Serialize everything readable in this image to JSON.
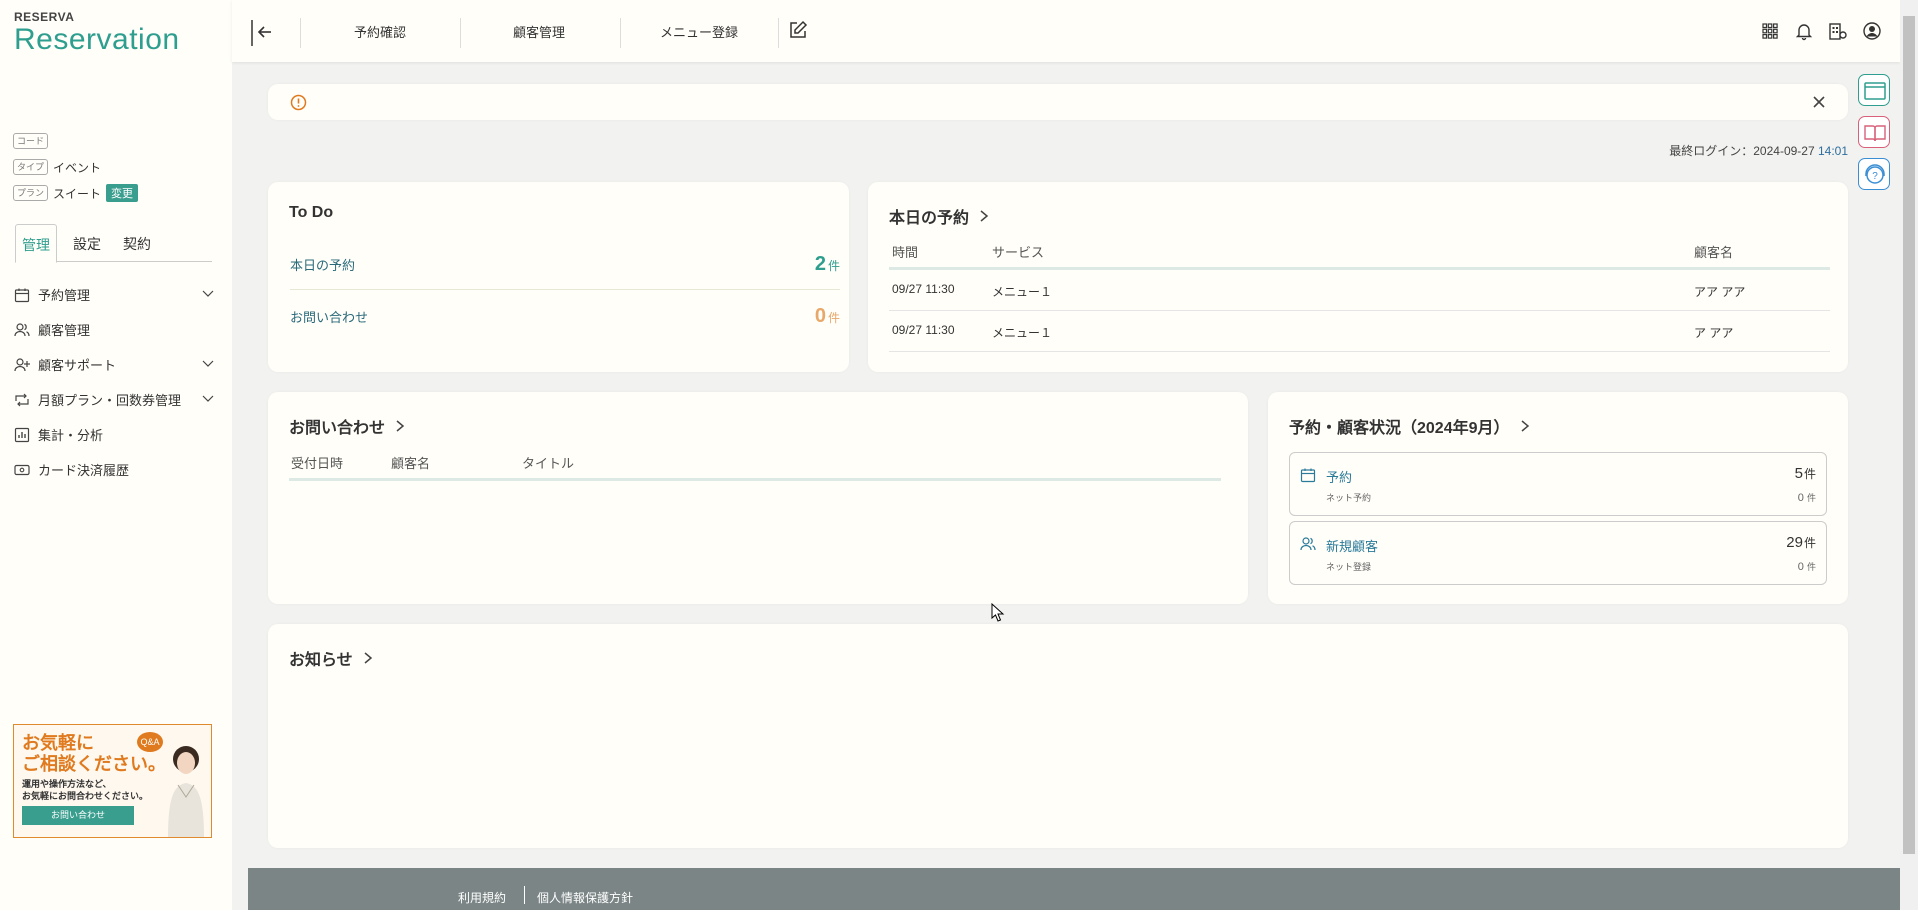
{
  "brand": {
    "small": "RESERVA",
    "big": "Reservation"
  },
  "meta": {
    "code_tag": "コード",
    "type_tag": "タイプ",
    "type_value": "イベント",
    "plan_tag": "プラン",
    "plan_value": "スイート",
    "change_label": "変更"
  },
  "sidebar": {
    "tabs": [
      {
        "label": "管理"
      },
      {
        "label": "設定"
      },
      {
        "label": "契約"
      }
    ],
    "items": [
      {
        "label": "予約管理"
      },
      {
        "label": "顧客管理"
      },
      {
        "label": "顧客サポート"
      },
      {
        "label": "月額プラン・回数券管理"
      },
      {
        "label": "集計・分析"
      },
      {
        "label": "カード決済履歴"
      }
    ],
    "banner": {
      "line1": "お気軽に",
      "line2": "ご相談ください。",
      "sub1": "運用や操作方法など、",
      "sub2": "お気軽にお問合わせください。",
      "button": "お問い合わせ",
      "qa": "Q&A"
    }
  },
  "topbar": {
    "links": [
      {
        "label": "予約確認"
      },
      {
        "label": "顧客管理"
      },
      {
        "label": "メニュー登録"
      }
    ]
  },
  "main": {
    "last_login_label": "最終ログイン：2024-09-27 ",
    "last_login_time": "14:01",
    "todo": {
      "title": "To Do",
      "rows": [
        {
          "label": "本日の予約",
          "count": "2",
          "unit": "件"
        },
        {
          "label": "お問い合わせ",
          "count": "0",
          "unit": "件"
        }
      ]
    },
    "today": {
      "title": "本日の予約",
      "headers": {
        "time": "時間",
        "service": "サービス",
        "customer": "顧客名"
      },
      "rows": [
        {
          "time": "09/27 11:30",
          "service": "メニュー１",
          "customer": "アア アア"
        },
        {
          "time": "09/27 11:30",
          "service": "メニュー１",
          "customer": "ア アア"
        }
      ]
    },
    "inquiries": {
      "title": "お問い合わせ",
      "headers": {
        "date": "受付日時",
        "customer": "顧客名",
        "subject": "タイトル"
      }
    },
    "status": {
      "title": "予約・顧客状況（2024年9月）",
      "boxes": [
        {
          "label": "予約",
          "sub": "ネット予約",
          "value": "5",
          "unit": "件",
          "subvalue": "0",
          "subunit": "件"
        },
        {
          "label": "新規顧客",
          "sub": "ネット登録",
          "value": "29",
          "unit": "件",
          "subvalue": "0",
          "subunit": "件"
        }
      ]
    },
    "news": {
      "title": "お知らせ"
    }
  },
  "footer": {
    "terms": "利用規約",
    "privacy": "個人情報保護方針"
  },
  "colors": {
    "accent": "#2e9e8e",
    "orange": "#e07a1e",
    "footer": "#7b8586"
  }
}
